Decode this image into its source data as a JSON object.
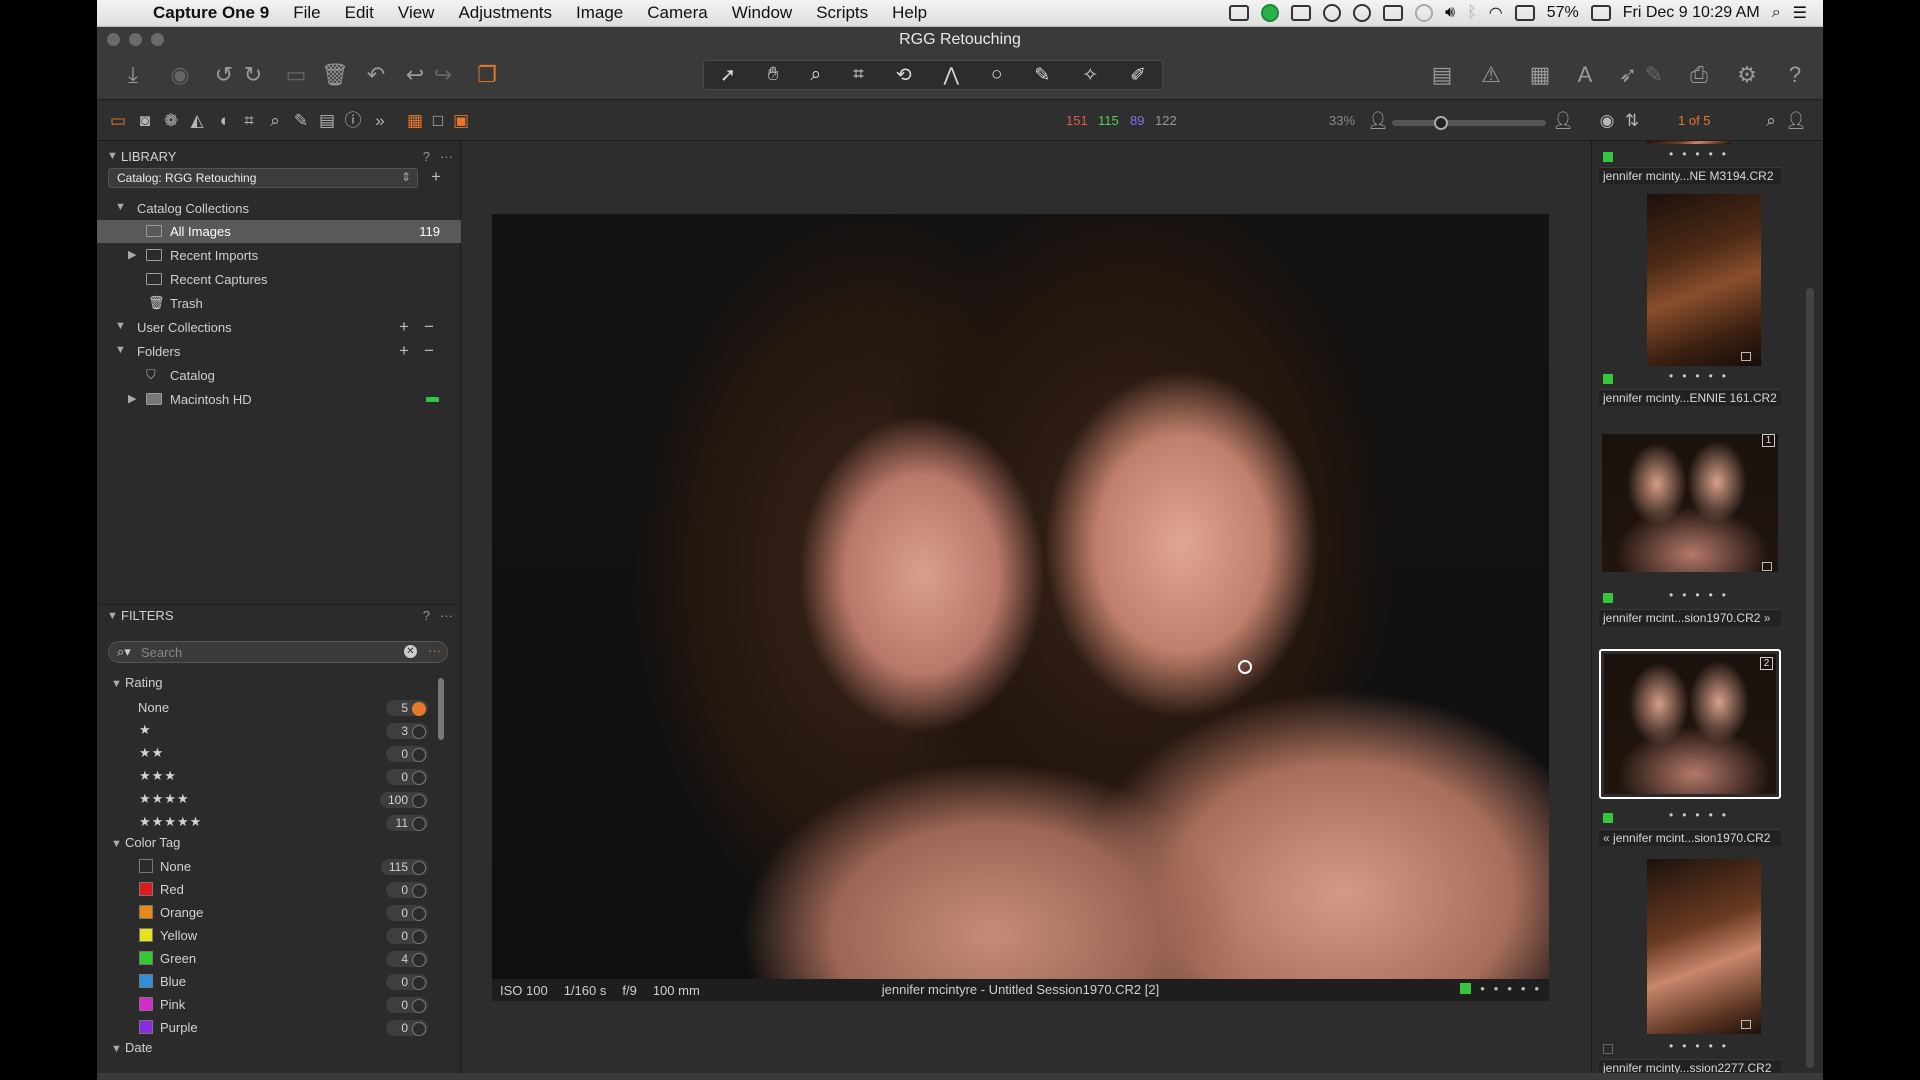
{
  "menubar": {
    "app_name": "Capture One 9",
    "menus": [
      "File",
      "Edit",
      "View",
      "Adjustments",
      "Image",
      "Camera",
      "Window",
      "Scripts",
      "Help"
    ],
    "battery": "57%",
    "clock": "Fri Dec 9  10:29 AM"
  },
  "window": {
    "title": "RGG Retouching"
  },
  "toolstrip": {
    "rgb": {
      "r": "151",
      "g": "115",
      "b": "89",
      "l": "122"
    },
    "zoom": "33%",
    "zoom_level": 0.3,
    "counter": "1 of 5"
  },
  "library": {
    "header": "LIBRARY",
    "help": "?",
    "more": "···",
    "catalog_select": "Catalog: RGG Retouching",
    "catalog_collections": "Catalog Collections",
    "items": [
      {
        "label": "All Images",
        "count": "119"
      },
      {
        "label": "Recent Imports"
      },
      {
        "label": "Recent Captures"
      },
      {
        "label": "Trash"
      }
    ],
    "user_collections": "User Collections",
    "folders": "Folders",
    "folder_items": [
      "Catalog",
      "Macintosh HD"
    ]
  },
  "filters": {
    "header": "FILTERS",
    "help": "?",
    "more": "···",
    "search_placeholder": "Search",
    "rating_header": "Rating",
    "ratings": [
      {
        "label": "None",
        "count": "5"
      },
      {
        "label": "★",
        "count": "3"
      },
      {
        "label": "★★",
        "count": "0"
      },
      {
        "label": "★★★",
        "count": "0"
      },
      {
        "label": "★★★★",
        "count": "100"
      },
      {
        "label": "★★★★★",
        "count": "11"
      }
    ],
    "color_header": "Color Tag",
    "colors": [
      {
        "label": "None",
        "count": "115",
        "color": "transparent"
      },
      {
        "label": "Red",
        "count": "0",
        "color": "#e0191e"
      },
      {
        "label": "Orange",
        "count": "0",
        "color": "#e58a16"
      },
      {
        "label": "Yellow",
        "count": "0",
        "color": "#e8e21a"
      },
      {
        "label": "Green",
        "count": "4",
        "color": "#35c835"
      },
      {
        "label": "Blue",
        "count": "0",
        "color": "#2f8fd8"
      },
      {
        "label": "Pink",
        "count": "0",
        "color": "#d42cc8"
      },
      {
        "label": "Purple",
        "count": "0",
        "color": "#8a2be2"
      }
    ],
    "date_header": "Date"
  },
  "viewer": {
    "iso": "ISO 100",
    "shutter": "1/160 s",
    "aperture": "f/9",
    "focal": "100 mm",
    "filename": "jennifer mcintyre - Untitled Session1970.CR2 [2]"
  },
  "browser": {
    "thumbs": [
      {
        "name": "jennifer mcinty...NE M3194.CR2",
        "badge": "",
        "tag": "green"
      },
      {
        "name": "jennifer mcinty...ENNIE 161.CR2",
        "badge": "",
        "tag": "green"
      },
      {
        "name": "jennifer mcint...sion1970.CR2",
        "badge": "1",
        "tag": "green",
        "suffix": "»"
      },
      {
        "name": "jennifer mcint...sion1970.CR2",
        "badge": "2",
        "tag": "green",
        "prefix": "«"
      },
      {
        "name": "jennifer mcinty...ssion2277.CR2",
        "badge": "",
        "tag": "none"
      }
    ]
  },
  "colors": {
    "accent": "#e5782a",
    "green_tag": "#36c63e"
  }
}
